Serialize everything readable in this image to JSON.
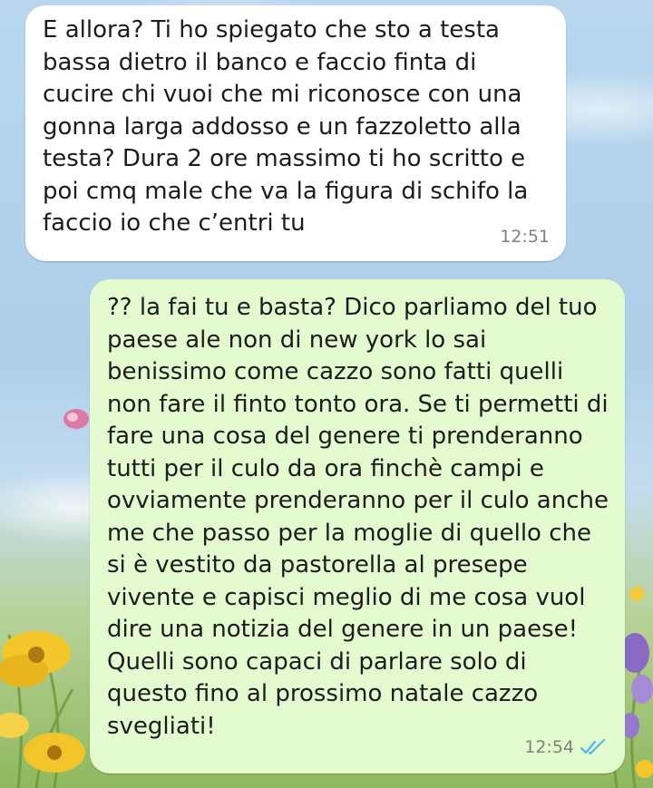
{
  "messages": [
    {
      "direction": "incoming",
      "text": "E allora? Ti ho spiegato che sto a testa bassa dietro il banco e faccio finta di cucire chi vuoi che mi riconosce con una gonna larga addosso e un fazzoletto alla testa? Dura 2 ore massimo ti ho scritto e poi cmq male che va la figura di schifo la faccio io che c’entri tu",
      "time": "12:51"
    },
    {
      "direction": "outgoing",
      "text": "?? la fai tu e basta? Dico parliamo del tuo paese ale non di new york lo sai benissimo come cazzo sono fatti quelli non fare il finto tonto ora. Se ti permetti di fare una cosa del genere ti prenderanno tutti per il culo da ora finchè campi e ovviamente prenderanno per il culo anche me che passo per la moglie di quello che si è vestito da pastorella al presepe vivente e capisci meglio di me cosa vuol dire una notizia del genere in un paese! Quelli sono capaci di parlare solo di questo fino al prossimo natale cazzo svegliati!",
      "time": "12:54",
      "status_icon": "double-check-icon",
      "status_color": "#4fb6ec"
    }
  ],
  "colors": {
    "incoming_bubble": "#ffffff",
    "outgoing_bubble": "#e4fbd0",
    "read_tick": "#4fb6ec"
  }
}
